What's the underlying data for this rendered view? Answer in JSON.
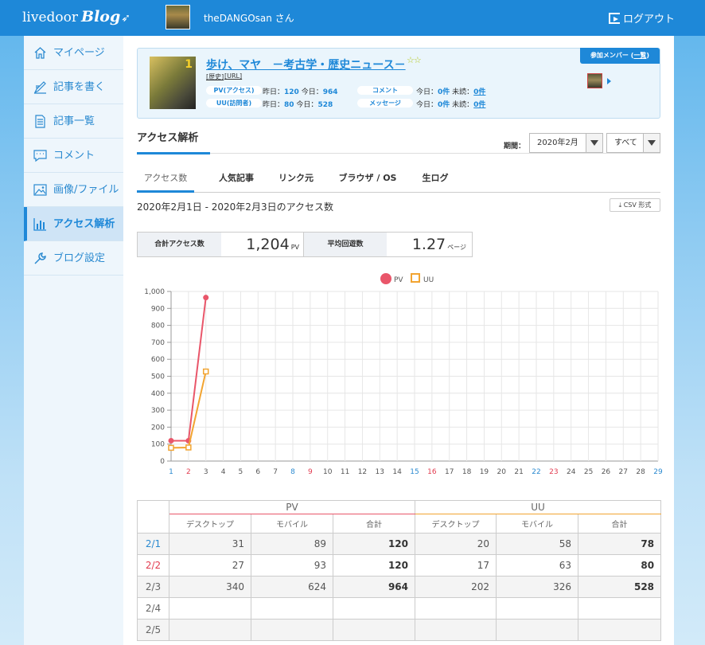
{
  "header": {
    "logo_text": "livedoor",
    "logo_blog": "Blog",
    "user_name": "theDANGOsan さん",
    "logout_label": "ログアウト"
  },
  "sidebar": {
    "items": [
      {
        "label": "マイページ",
        "icon": "home-icon"
      },
      {
        "label": "記事を書く",
        "icon": "pen-icon"
      },
      {
        "label": "記事一覧",
        "icon": "list-icon"
      },
      {
        "label": "コメント",
        "icon": "comment-icon"
      },
      {
        "label": "画像/ファイル",
        "icon": "image-icon"
      },
      {
        "label": "アクセス解析",
        "icon": "bar-chart-icon",
        "active": true
      },
      {
        "label": "ブログ設定",
        "icon": "wrench-icon"
      }
    ]
  },
  "blog": {
    "title": "歩け、マヤ　－考古学・歴史ニュース－",
    "tag_category": "[歴史]",
    "tag_url": "[URL]",
    "pv_label": "PV(アクセス)",
    "pv_yesterday": "昨日：",
    "pv_yesterday_val": "120",
    "pv_today": "今日：",
    "pv_today_val": "964",
    "uu_label": "UU(訪問者)",
    "uu_yesterday": "昨日：",
    "uu_yesterday_val": "80",
    "uu_today": "今日：",
    "uu_today_val": "528",
    "comment_label": "コメント",
    "comment_today": "今日：",
    "comment_today_val": "0件",
    "comment_unread": "未読：",
    "comment_unread_val": "0件",
    "message_label": "メッセージ",
    "message_today": "今日：",
    "message_today_val": "0件",
    "message_unread": "未読：",
    "message_unread_val": "0件",
    "member_label": "参加メンバー",
    "member_list": "一覧"
  },
  "analysis": {
    "section_title": "アクセス解析",
    "period_label": "期間：",
    "period_value": "2020年2月",
    "filter_value": "すべて",
    "tabs": [
      "アクセス数",
      "人気記事",
      "リンク元",
      "ブラウザ / OS",
      "生ログ"
    ],
    "date_range": "2020年2月1日 - 2020年2月3日のアクセス数",
    "csv_label": "CSV 形式",
    "total_label": "合計アクセス数",
    "total_value": "1,204",
    "total_unit": "PV",
    "avg_label": "平均回遊数",
    "avg_value": "1.27",
    "avg_unit": "ページ"
  },
  "chart_data": {
    "type": "line",
    "x": [
      1,
      2,
      3,
      4,
      5,
      6,
      7,
      8,
      9,
      10,
      11,
      12,
      13,
      14,
      15,
      16,
      17,
      18,
      19,
      20,
      21,
      22,
      23,
      24,
      25,
      26,
      27,
      28,
      29
    ],
    "x_colors": {
      "1": "#2b8ad0",
      "2": "#e23c50",
      "8": "#2b8ad0",
      "9": "#e23c50",
      "15": "#2b8ad0",
      "16": "#e23c50",
      "22": "#2b8ad0",
      "23": "#e23c50",
      "29": "#2b8ad0"
    },
    "series": [
      {
        "name": "PV",
        "color": "#e9566a",
        "values": [
          120,
          120,
          964
        ]
      },
      {
        "name": "UU",
        "color": "#f2a431",
        "values": [
          78,
          80,
          528
        ]
      }
    ],
    "ylim": [
      0,
      1000
    ],
    "yticks": [
      0,
      100,
      200,
      300,
      400,
      500,
      600,
      700,
      800,
      900,
      1000
    ],
    "ytick_labels": [
      "0",
      "100",
      "200",
      "300",
      "400",
      "500",
      "600",
      "700",
      "800",
      "900",
      "1,000"
    ],
    "grid": true,
    "legend": "top"
  },
  "table": {
    "group_headers": [
      "PV",
      "UU"
    ],
    "sub_headers": [
      "デスクトップ",
      "モバイル",
      "合計",
      "デスクトップ",
      "モバイル",
      "合計"
    ],
    "rows": [
      {
        "date": "2/1",
        "color": "blue",
        "cells": [
          "31",
          "89",
          "120",
          "20",
          "58",
          "78"
        ]
      },
      {
        "date": "2/2",
        "color": "red",
        "cells": [
          "27",
          "93",
          "120",
          "17",
          "63",
          "80"
        ]
      },
      {
        "date": "2/3",
        "color": "",
        "cells": [
          "340",
          "624",
          "964",
          "202",
          "326",
          "528"
        ]
      },
      {
        "date": "2/4",
        "color": "",
        "cells": [
          "",
          "",
          "",
          "",
          "",
          ""
        ]
      },
      {
        "date": "2/5",
        "color": "",
        "cells": [
          "",
          "",
          "",
          "",
          "",
          ""
        ]
      }
    ]
  }
}
